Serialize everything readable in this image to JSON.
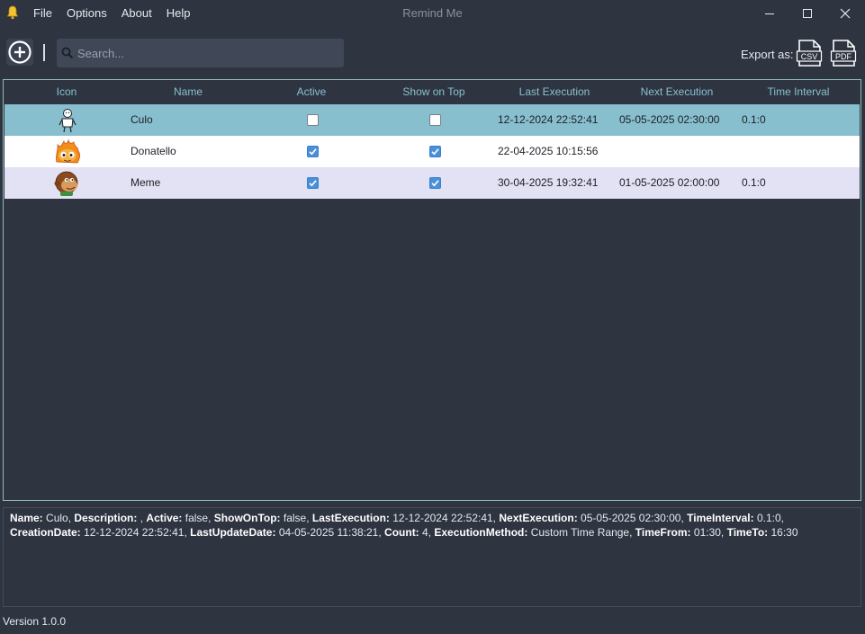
{
  "window": {
    "title": "Remind Me",
    "icon": "bell-icon",
    "menu": [
      "File",
      "Options",
      "About",
      "Help"
    ]
  },
  "toolbar": {
    "search_placeholder": "Search...",
    "export_label": "Export as:",
    "export_csv": "CSV",
    "export_pdf": "PDF"
  },
  "table": {
    "columns": [
      "Icon",
      "Name",
      "Active",
      "Show on Top",
      "Last Execution",
      "Next Execution",
      "Time Interval"
    ],
    "rows": [
      {
        "icon": "stick-figure-icon",
        "name": "Culo",
        "active": false,
        "show_on_top": false,
        "last_execution": "12-12-2024 22:52:41",
        "next_execution": "05-05-2025 02:30:00",
        "time_interval": "0.1:0",
        "state": "selected"
      },
      {
        "icon": "flame-face-icon",
        "name": "Donatello",
        "active": true,
        "show_on_top": true,
        "last_execution": "22-04-2025 10:15:56",
        "next_execution": "",
        "time_interval": "",
        "state": "normal"
      },
      {
        "icon": "monkey-face-icon",
        "name": "Meme",
        "active": true,
        "show_on_top": true,
        "last_execution": "30-04-2025 19:32:41",
        "next_execution": "01-05-2025 02:00:00",
        "time_interval": "0.1:0",
        "state": "alternate"
      }
    ]
  },
  "details": [
    {
      "k": "Name:",
      "v": " Culo, "
    },
    {
      "k": "Description:",
      "v": " , "
    },
    {
      "k": "Active:",
      "v": " false, "
    },
    {
      "k": "ShowOnTop:",
      "v": " false, "
    },
    {
      "k": "LastExecution:",
      "v": " 12-12-2024 22:52:41, "
    },
    {
      "k": "NextExecution:",
      "v": " 05-05-2025 02:30:00, "
    },
    {
      "k": "TimeInterval:",
      "v": " 0.1:0, "
    },
    {
      "k": "CreationDate:",
      "v": " 12-12-2024 22:52:41, "
    },
    {
      "k": "LastUpdateDate:",
      "v": " 04-05-2025 11:38:21, "
    },
    {
      "k": "Count:",
      "v": " 4, "
    },
    {
      "k": "ExecutionMethod:",
      "v": " Custom Time Range, "
    },
    {
      "k": "TimeFrom:",
      "v": " 01:30, "
    },
    {
      "k": "TimeTo:",
      "v": " 16:30"
    }
  ],
  "status": {
    "version": "Version 1.0.0"
  },
  "colors": {
    "background": "#2e3440",
    "header_text": "#88c0d0",
    "row_selected": "#88bfcf",
    "row_normal": "#ffffff",
    "row_alternate": "#e3e1f4",
    "grid_border": "#8fbcbb",
    "checkbox_checked": "#4a90d9"
  }
}
